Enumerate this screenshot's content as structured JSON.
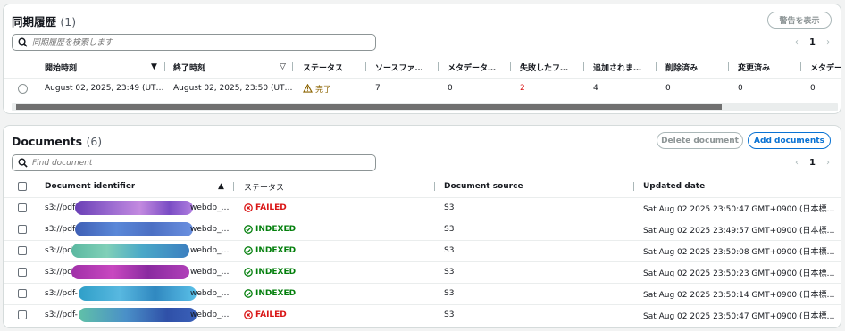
{
  "history": {
    "title": "同期履歴",
    "count": "(1)",
    "warn_button": "警告を表示",
    "search_placeholder": "同期履歴を検索します",
    "page": "1",
    "prev_icon": "chevron-left",
    "next_icon": "chevron-right",
    "columns": [
      "開始時刻",
      "終了時刻",
      "ステータス",
      "ソースファ…",
      "メタデータ…",
      "失敗したフ…",
      "追加されま…",
      "削除済み",
      "変更済み",
      "メタデー"
    ],
    "rows": [
      {
        "start": "August 02, 2025, 23:49 (UT…",
        "end": "August 02, 2025, 23:50 (UT…",
        "status": "完了",
        "source": "7",
        "metadata": "0",
        "failed": "2",
        "added": "4",
        "deleted": "0",
        "modified": "0",
        "meta2": "0"
      }
    ]
  },
  "documents": {
    "title": "Documents",
    "count": "(6)",
    "delete_button": "Delete document",
    "add_button": "Add documents",
    "search_placeholder": "Find document",
    "page": "1",
    "columns": [
      "Document identifier",
      "ステータス",
      "Document source",
      "Updated date"
    ],
    "rows": [
      {
        "id_prefix": "s3://pdf",
        "id_suffix": "webdb_…",
        "status": "FAILED",
        "source": "S3",
        "updated": "Sat Aug 02 2025 23:50:47 GMT+0900 (日本標…"
      },
      {
        "id_prefix": "s3://pdf",
        "id_suffix": "webdb_…",
        "status": "INDEXED",
        "source": "S3",
        "updated": "Sat Aug 02 2025 23:49:57 GMT+0900 (日本標…"
      },
      {
        "id_prefix": "s3://pd",
        "id_suffix": "webdb_…",
        "status": "INDEXED",
        "source": "S3",
        "updated": "Sat Aug 02 2025 23:50:08 GMT+0900 (日本標…"
      },
      {
        "id_prefix": "s3://pd",
        "id_suffix": "webdb_…",
        "status": "INDEXED",
        "source": "S3",
        "updated": "Sat Aug 02 2025 23:50:23 GMT+0900 (日本標…"
      },
      {
        "id_prefix": "s3://pdf-",
        "id_suffix": "webdb_…",
        "status": "INDEXED",
        "source": "S3",
        "updated": "Sat Aug 02 2025 23:50:14 GMT+0900 (日本標…"
      },
      {
        "id_prefix": "s3://pdf-",
        "id_suffix": "webdb_…",
        "status": "FAILED",
        "source": "S3",
        "updated": "Sat Aug 02 2025 23:50:47 GMT+0900 (日本標…"
      }
    ]
  },
  "colors": {
    "accent": "#0972d3",
    "failed": "#d91515",
    "indexed": "#037f0c",
    "warning": "#8d6605"
  }
}
